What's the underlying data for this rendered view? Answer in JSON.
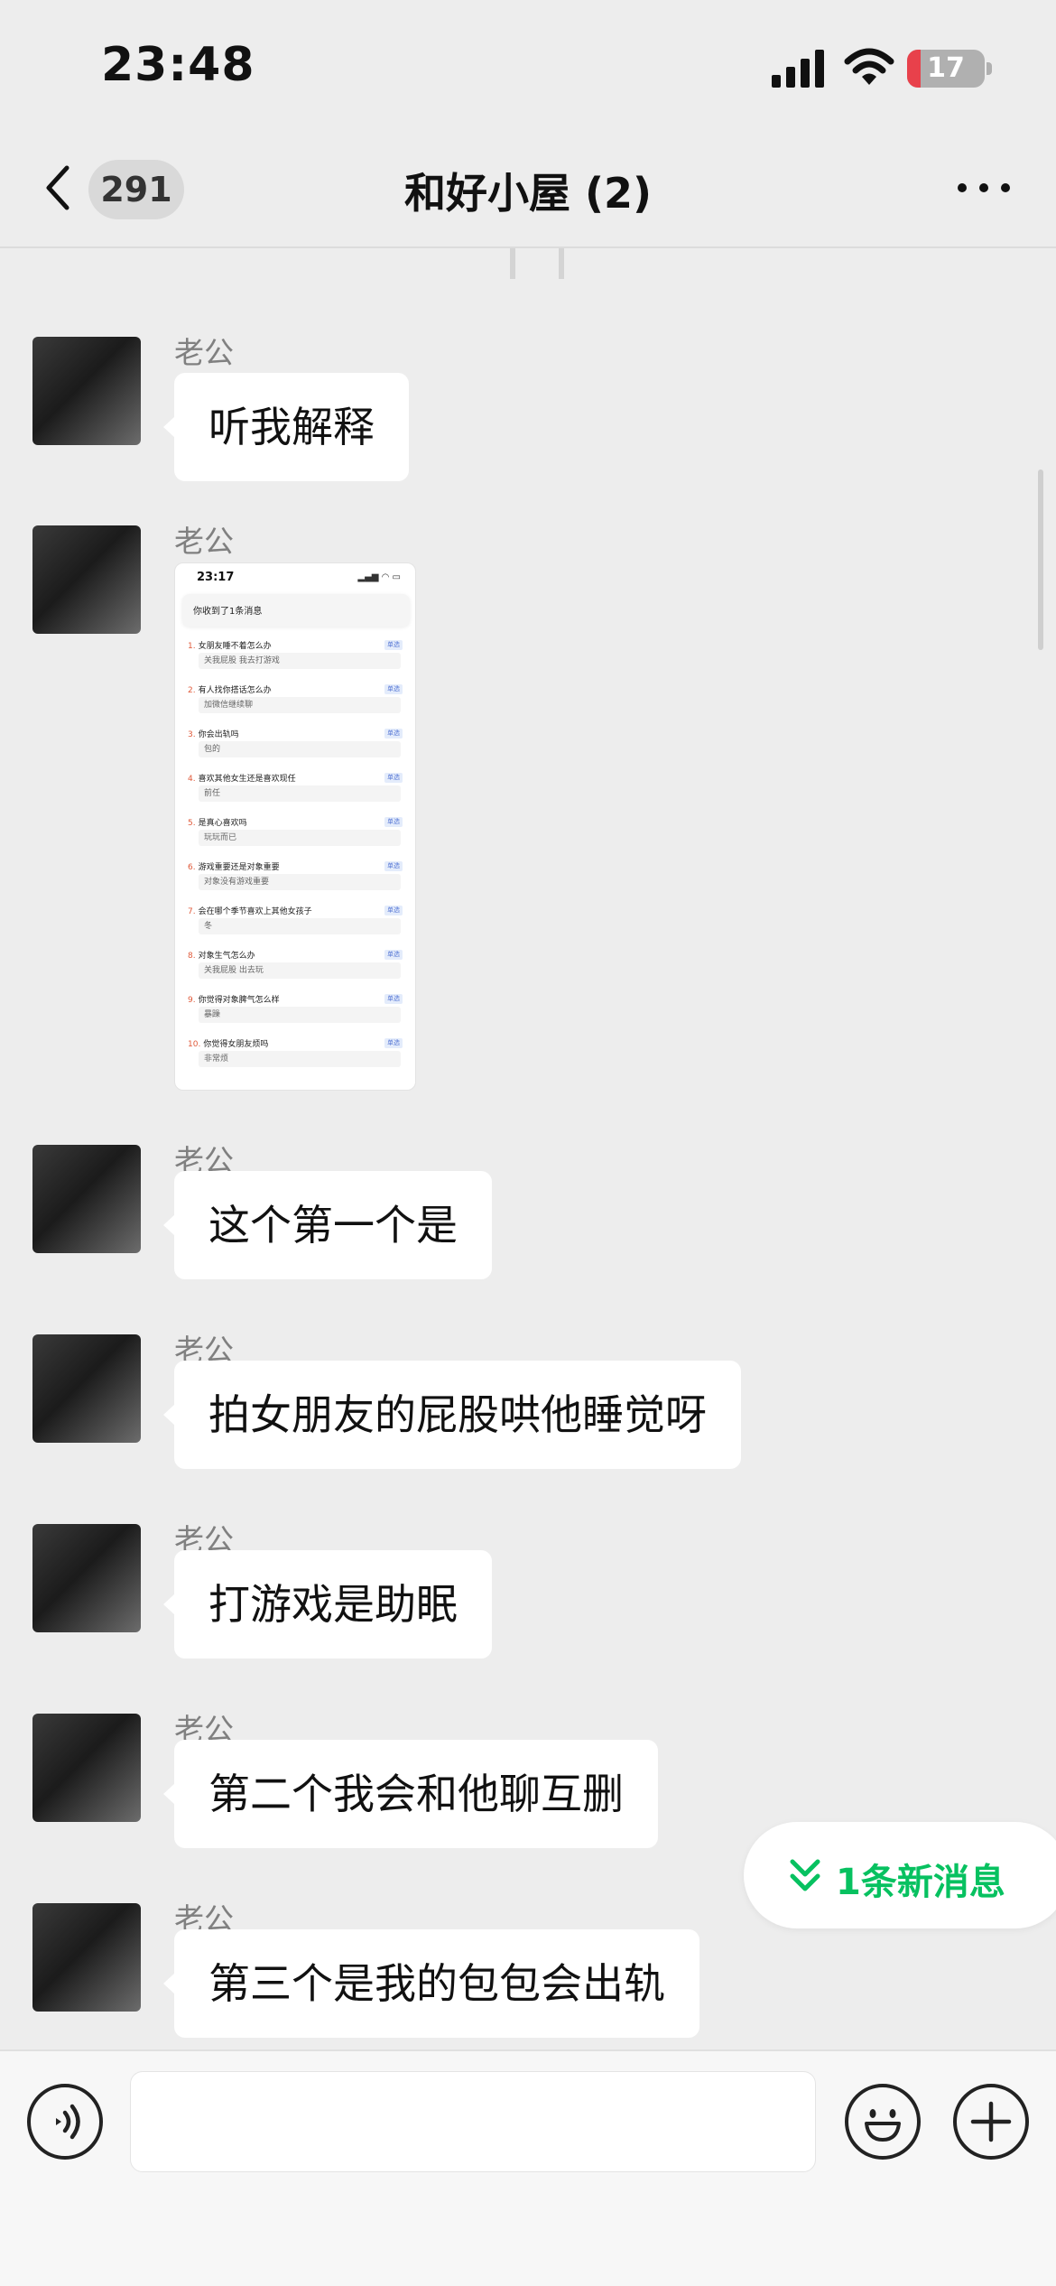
{
  "status_bar": {
    "time": "23:48",
    "battery": "17",
    "battery_level": 0.17
  },
  "nav": {
    "unread_count": "291",
    "title": "和好小屋 (2)"
  },
  "messages": [
    {
      "sender": "老公",
      "text": "听我解释"
    },
    {
      "sender": "老公",
      "type": "image",
      "image": {
        "time": "23:17",
        "banner": "你收到了1条消息",
        "items": [
          {
            "n": "1.",
            "q": "女朋友睡不着怎么办",
            "a": "关我屁股 我去打游戏",
            "tag": "单选"
          },
          {
            "n": "2.",
            "q": "有人找你搭话怎么办",
            "a": "加微信继续聊",
            "tag": "单选"
          },
          {
            "n": "3.",
            "q": "你会出轨吗",
            "a": "包的",
            "tag": "单选"
          },
          {
            "n": "4.",
            "q": "喜欢其他女生还是喜欢现任",
            "a": "前任",
            "tag": "单选"
          },
          {
            "n": "5.",
            "q": "是真心喜欢吗",
            "a": "玩玩而已",
            "tag": "单选"
          },
          {
            "n": "6.",
            "q": "游戏重要还是对象重要",
            "a": "对象没有游戏重要",
            "tag": "单选"
          },
          {
            "n": "7.",
            "q": "会在哪个季节喜欢上其他女孩子",
            "a": "冬",
            "tag": "单选"
          },
          {
            "n": "8.",
            "q": "对象生气怎么办",
            "a": "关我屁股 出去玩",
            "tag": "单选"
          },
          {
            "n": "9.",
            "q": "你觉得对象脾气怎么样",
            "a": "暴躁",
            "tag": "单选"
          },
          {
            "n": "10.",
            "q": "你觉得女朋友烦吗",
            "a": "非常烦",
            "tag": "单选"
          }
        ]
      }
    },
    {
      "sender": "老公",
      "text": "这个第一个是"
    },
    {
      "sender": "老公",
      "text": "拍女朋友的屁股哄他睡觉呀"
    },
    {
      "sender": "老公",
      "text": "打游戏是助眠"
    },
    {
      "sender": "老公",
      "text": "第二个我会和他聊互删"
    },
    {
      "sender": "老公",
      "text": "第三个是我的包包会出轨"
    }
  ],
  "new_messages": "1条新消息",
  "input": {
    "value": ""
  }
}
